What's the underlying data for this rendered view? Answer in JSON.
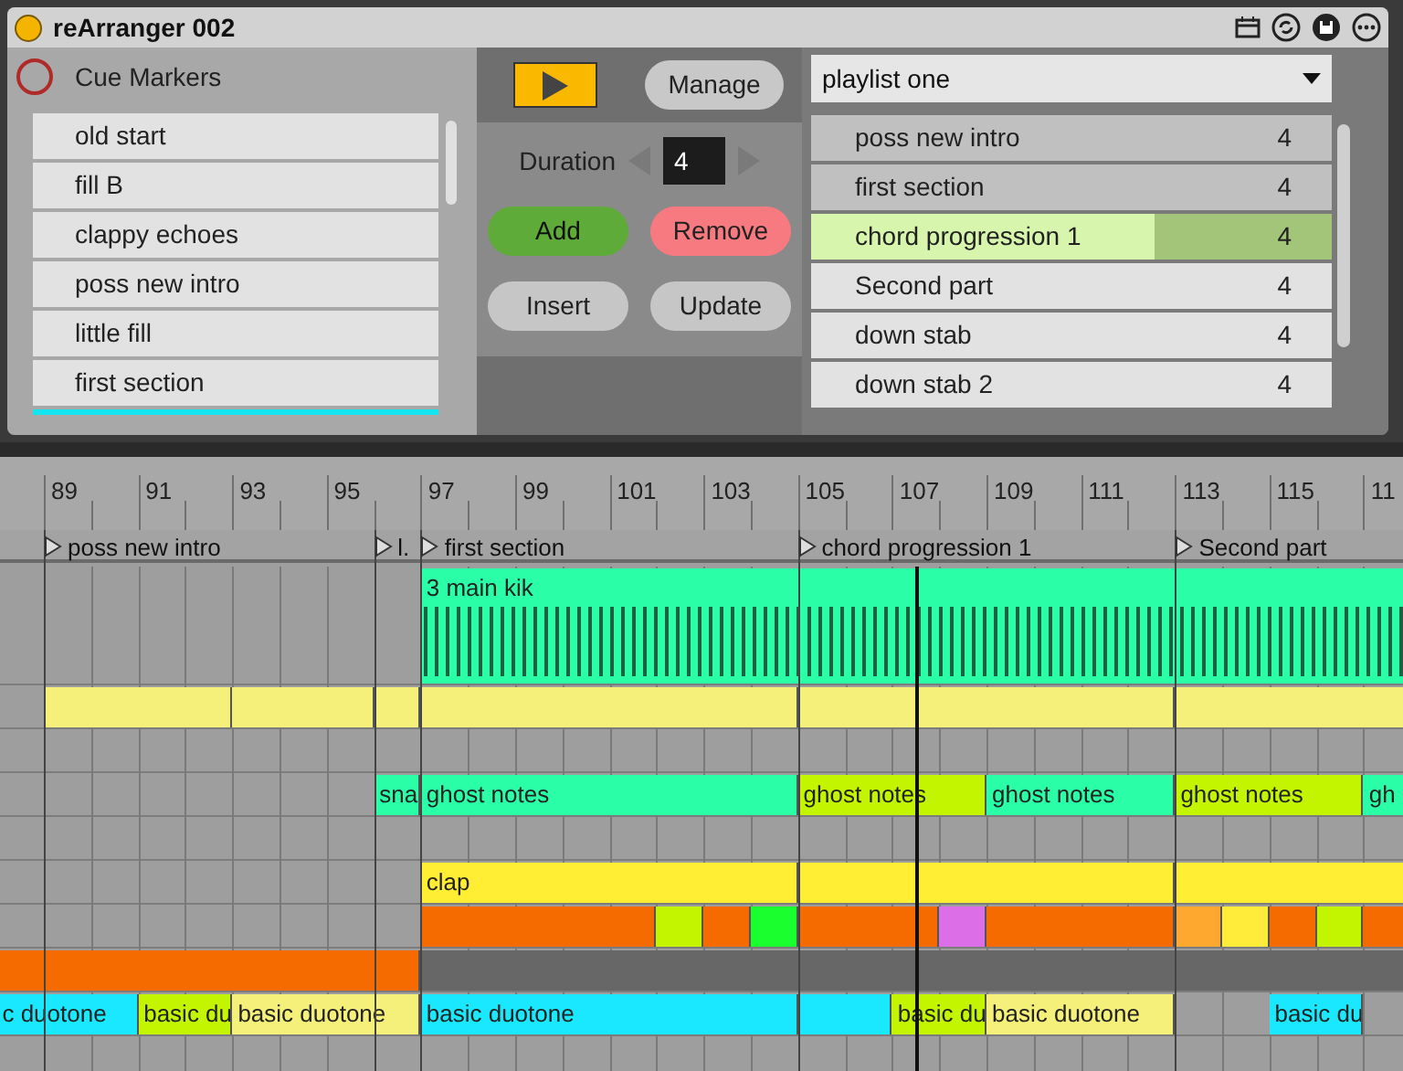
{
  "device": {
    "title": "reArranger 002",
    "cue_markers": {
      "label": "Cue Markers",
      "armed": false,
      "items": [
        {
          "label": "old start"
        },
        {
          "label": "fill B"
        },
        {
          "label": "clappy echoes"
        },
        {
          "label": "poss new intro"
        },
        {
          "label": "little fill"
        },
        {
          "label": "first section"
        }
      ]
    },
    "transport": {
      "playing": false,
      "manage": "Manage",
      "duration_label": "Duration",
      "duration": "4",
      "buttons": [
        {
          "label": "Add",
          "kind": "add"
        },
        {
          "label": "Remove",
          "kind": "remove"
        },
        {
          "label": "Insert",
          "kind": "plain"
        },
        {
          "label": "Update",
          "kind": "plain"
        }
      ]
    },
    "playlist": {
      "selected_playlist": "playlist one",
      "rows": [
        {
          "label": "poss new intro",
          "count": "4",
          "played": true,
          "selected": false
        },
        {
          "label": "first section",
          "count": "4",
          "played": true,
          "selected": false
        },
        {
          "label": "chord progression 1",
          "count": "4",
          "played": false,
          "selected": true,
          "level": 0.66
        },
        {
          "label": "Second part",
          "count": "4",
          "played": false,
          "selected": false
        },
        {
          "label": "down stab",
          "count": "4",
          "played": false,
          "selected": false
        },
        {
          "label": "down stab 2",
          "count": "4",
          "played": false,
          "selected": false
        }
      ]
    }
  },
  "arrangement": {
    "ruler": [
      "89",
      "91",
      "93",
      "95",
      "97",
      "99",
      "101",
      "103",
      "105",
      "107",
      "109",
      "111",
      "113",
      "115",
      "11"
    ],
    "locators": [
      {
        "label": "poss new intro"
      },
      {
        "label": "l."
      },
      {
        "label": "first section"
      },
      {
        "label": "chord progression 1"
      },
      {
        "label": "Second part"
      }
    ],
    "tracks": [
      {
        "clips": [
          {
            "name": "3 main kik",
            "color": "#2affa8"
          }
        ]
      },
      {
        "clips": [
          {
            "color": "#f5f07a"
          },
          {
            "color": "#f5f07a"
          },
          {
            "color": "#f5f07a"
          },
          {
            "color": "#f5f07a"
          },
          {
            "color": "#f5f07a"
          },
          {
            "color": "#f5f07a"
          }
        ]
      },
      {
        "clips": [
          {
            "name": "sna",
            "color": "#2affa8"
          },
          {
            "name": "ghost notes",
            "color": "#2affa8"
          },
          {
            "name": "ghost notes",
            "color": "#c4f500"
          },
          {
            "name": "ghost notes",
            "color": "#2affa8"
          },
          {
            "name": "ghost notes",
            "color": "#c4f500"
          },
          {
            "name": "gh",
            "color": "#2affa8"
          }
        ]
      },
      {
        "clips": [
          {
            "name": "clap",
            "color": "#ffee33"
          },
          {
            "color": "#ffee33"
          },
          {
            "color": "#ffee33"
          }
        ]
      },
      {
        "clips": [
          {
            "color": "#f56b00"
          },
          {
            "color": "#c4f500"
          },
          {
            "color": "#f56b00"
          },
          {
            "color": "#1aff2e"
          },
          {
            "color": "#f56b00"
          },
          {
            "color": "#dc6ee8"
          },
          {
            "color": "#f56b00"
          },
          {
            "color": "#ffa830"
          },
          {
            "color": "#ffec3a"
          },
          {
            "color": "#f56b00"
          },
          {
            "color": "#c4f500"
          },
          {
            "color": "#f56b00"
          }
        ]
      },
      {
        "clips": [
          {
            "color": "#f56b00"
          },
          {
            "color": "#676767"
          }
        ]
      },
      {
        "clips": [
          {
            "name": "c duotone",
            "color": "#1ae8ff"
          },
          {
            "name": "basic du",
            "color": "#c4f500"
          },
          {
            "name": "basic duotone",
            "color": "#f5f07a"
          },
          {
            "name": "basic duotone",
            "color": "#1ae8ff"
          },
          {
            "color": "#1ae8ff"
          },
          {
            "name": "basic du",
            "color": "#c4f500"
          },
          {
            "name": "basic duotone",
            "color": "#f5f07a"
          },
          {
            "name": "basic du",
            "color": "#1ae8ff"
          }
        ]
      }
    ]
  }
}
